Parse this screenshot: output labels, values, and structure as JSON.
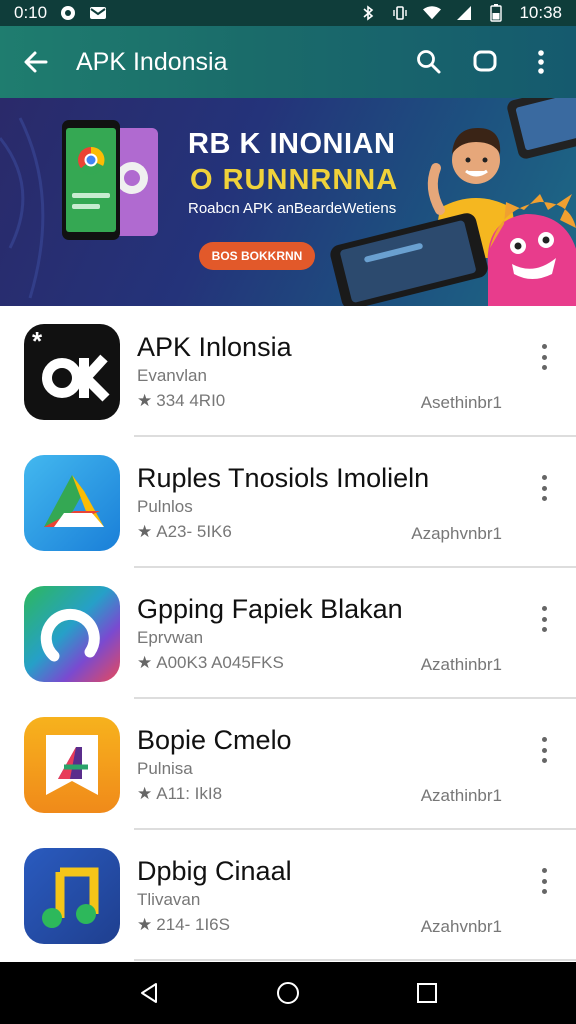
{
  "status_bar": {
    "time_left": "0:10",
    "time_right": "10:38",
    "icons": [
      "notification-icon",
      "mail-icon",
      "bluetooth-icon",
      "vibrate-icon",
      "wifi-icon",
      "signal-icon",
      "battery-icon"
    ]
  },
  "app_bar": {
    "title": "APK Indonsia",
    "icons": [
      "back-arrow-icon",
      "search-icon",
      "chat-icon",
      "more-vert-icon"
    ]
  },
  "banner": {
    "heading": "RB K INONIAN",
    "subheading": "O RUNNRNNA",
    "tagline": "Roabcn APK anBeardeWetiens",
    "cta_label": "BOS BOKKRNN",
    "colors": {
      "accent_yellow": "#f0d23a",
      "cta": "#e2592a"
    }
  },
  "apps": [
    {
      "name": "APK Inlonsia",
      "developer": "Evanvlan",
      "meta": "334 4RI0",
      "tag": "Asethinbr1",
      "icon": "ok-logo-icon"
    },
    {
      "name": "Ruples Tnosiols Imolieln",
      "developer": "Pulnlos",
      "meta": "A23- 5IK6",
      "tag": "Azaphvnbr1",
      "icon": "drive-logo-icon"
    },
    {
      "name": "Gpping Fapiek Blakan",
      "developer": "Eprvwan",
      "meta": "A00K3 A045FKS",
      "tag": "Azathinbr1",
      "icon": "ring-logo-icon"
    },
    {
      "name": "Bopie Cmelo",
      "developer": "Pulnisa",
      "meta": "A11: IkI8",
      "tag": "Azathinbr1",
      "icon": "bookmark-logo-icon"
    },
    {
      "name": "Dpbig Cinaal",
      "developer": "Tlivavan",
      "meta": "214- 1I6S",
      "tag": "Azahvnbr1",
      "icon": "music-note-icon"
    }
  ],
  "nav_bar": {
    "icons": [
      "back-triangle-icon",
      "home-circle-icon",
      "recents-square-icon"
    ]
  }
}
